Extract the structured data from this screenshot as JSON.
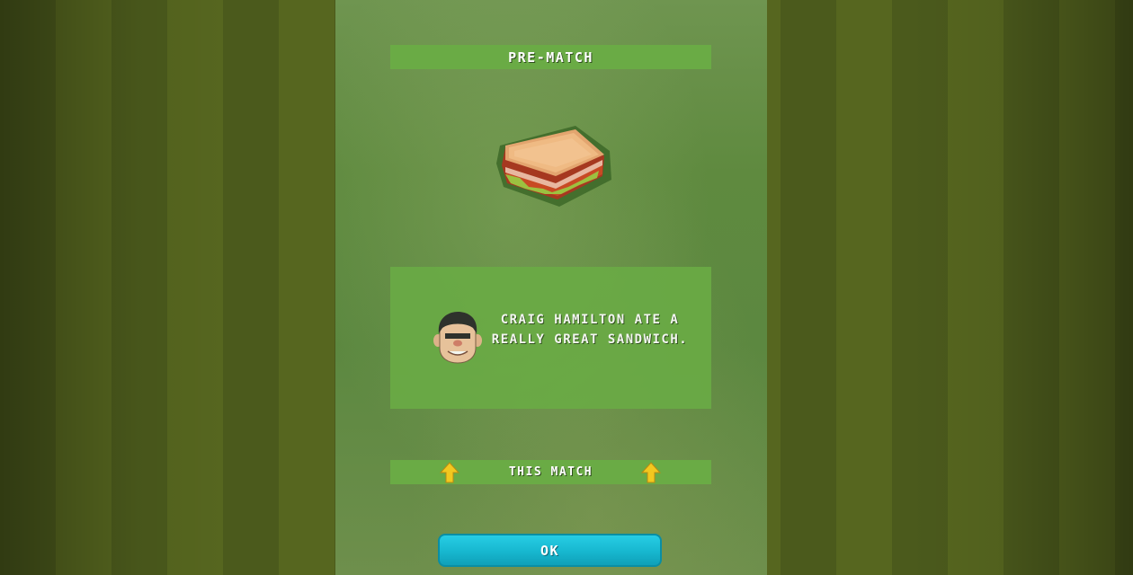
{
  "screen": {
    "title": "PRE-MATCH"
  },
  "event": {
    "item_icon": "sandwich-icon",
    "portrait_icon": "player-portrait-icon",
    "message": "CRAIG HAMILTON ATE A REALLY GREAT SANDWICH."
  },
  "effect": {
    "label": "THIS MATCH",
    "arrow_icon": "arrow-up-icon"
  },
  "buttons": {
    "ok_label": "OK"
  },
  "colors": {
    "bar_green": "#6aab45",
    "button_cyan": "#17b7cf",
    "arrow_yellow": "#f2c81f"
  }
}
